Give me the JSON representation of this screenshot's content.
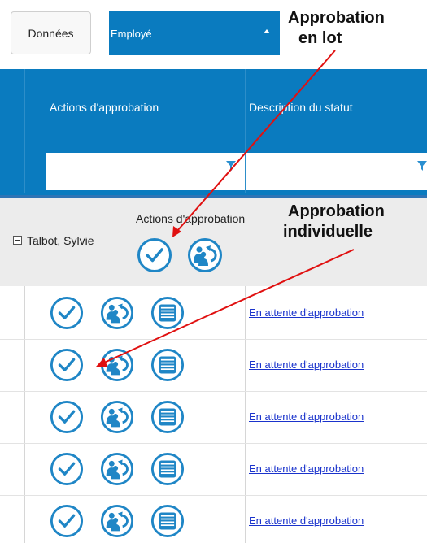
{
  "toolbar": {
    "donnees_label": "Données",
    "employe_select_value": "Employé"
  },
  "annotations": {
    "batch_line1": "Approbation",
    "batch_line2": "en lot",
    "individual_line1": "Approbation",
    "individual_line2": "individuelle"
  },
  "grid": {
    "columns": [
      "Actions d'approbation",
      "Description du statut"
    ],
    "group": {
      "name": "Talbot, Sylvie",
      "actions_label": "Actions d'approbation"
    },
    "rows": [
      {
        "status": "En attente d'approbation"
      },
      {
        "status": "En attente d'approbation"
      },
      {
        "status": "En attente d'approbation"
      },
      {
        "status": "En attente d'approbation"
      },
      {
        "status": "En attente d'approbation"
      }
    ]
  },
  "colors": {
    "brand_blue": "#0a7bbf",
    "icon_blue": "#1f86c6",
    "arrow_red": "#e01010",
    "link_blue": "#1a33cc"
  },
  "icons": [
    "approve-icon",
    "return-to-employee-icon",
    "details-list-icon",
    "filter-icon",
    "collapse-icon"
  ]
}
